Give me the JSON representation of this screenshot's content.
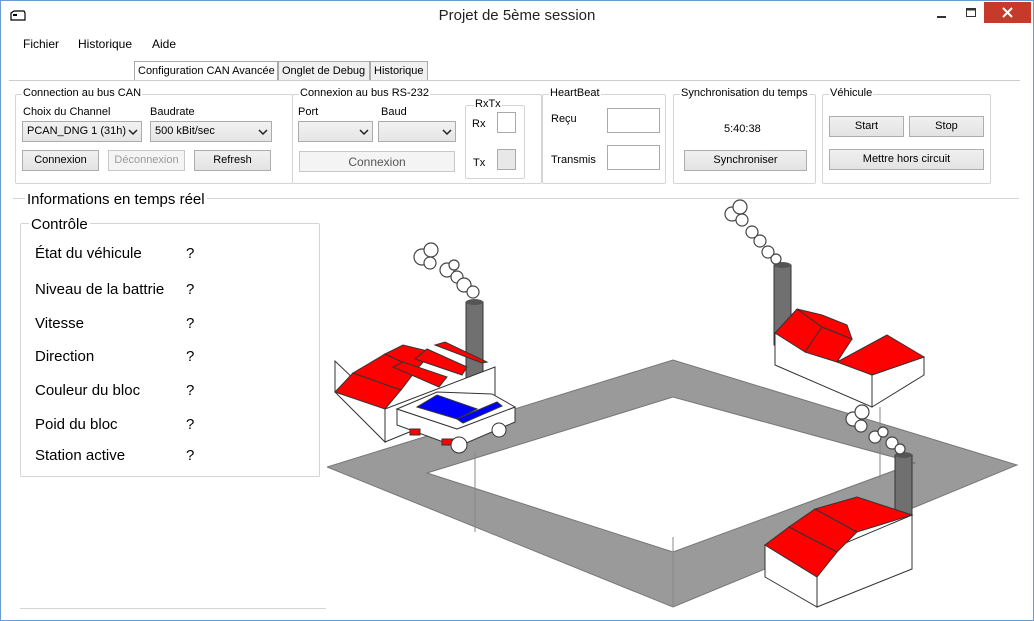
{
  "window": {
    "title": "Projet de 5ème session"
  },
  "menu": {
    "items": [
      "Fichier",
      "Historique",
      "Aide"
    ]
  },
  "tabs": [
    "Configuration CAN Avancée",
    "Onglet de Debug",
    "Historique"
  ],
  "can": {
    "group_label": "Connection au bus CAN",
    "channel_label": "Choix du Channel",
    "channel_value": "PCAN_DNG 1 (31h)",
    "baudrate_label": "Baudrate",
    "baudrate_value": "500 kBit/sec",
    "connect_label": "Connexion",
    "disconnect_label": "Déconnexion",
    "refresh_label": "Refresh"
  },
  "rs232": {
    "group_label": "Connexion au bus RS-232",
    "port_label": "Port",
    "port_value": "",
    "baud_label": "Baud",
    "baud_value": "",
    "connect_label": "Connexion",
    "rxtx_label": "RxTx",
    "rx_label": "Rx",
    "tx_label": "Tx"
  },
  "heartbeat": {
    "group_label": "HeartBeat",
    "received_label": "Reçu",
    "transmit_label": "Transmis"
  },
  "sync": {
    "group_label": "Synchronisation du temps",
    "time": "5:40:38",
    "button_label": "Synchroniser"
  },
  "vehicle": {
    "group_label": "Véhicule",
    "start_label": "Start",
    "stop_label": "Stop",
    "offline_label": "Mettre hors circuit"
  },
  "realtime": {
    "section_label": "Informations en temps réel",
    "control_label": "Contrôle",
    "rows": [
      {
        "label": "État du véhicule",
        "value": "?"
      },
      {
        "label": "Niveau de la battrie",
        "value": "?"
      },
      {
        "label": "Vitesse",
        "value": "?"
      },
      {
        "label": "Direction",
        "value": "?"
      },
      {
        "label": "Couleur du bloc",
        "value": "?"
      },
      {
        "label": "Poid du bloc",
        "value": "?"
      },
      {
        "label": "Station active",
        "value": "?"
      }
    ]
  },
  "colors": {
    "roof": "#ff0000",
    "track": "#9a9a9a",
    "chimney": "#707070",
    "car_window": "#0000ff"
  },
  "icons": [
    "app-icon",
    "minimize-icon",
    "maximize-icon",
    "close-icon",
    "chevron-down-icon"
  ]
}
